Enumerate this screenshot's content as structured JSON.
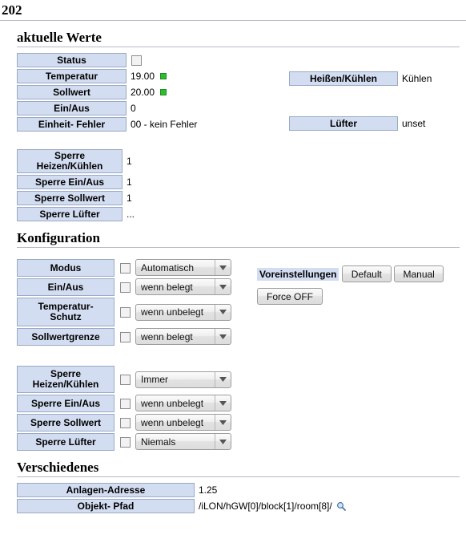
{
  "page": {
    "title": "202"
  },
  "sections": {
    "current_values": {
      "heading": "aktuelle Werte",
      "rows": [
        {
          "label": "Status",
          "value": "",
          "control": "checkbox"
        },
        {
          "label": "Temperatur",
          "value": "19.00",
          "indicator": "green"
        },
        {
          "label": "Sollwert",
          "value": "20.00",
          "indicator": "green"
        },
        {
          "label": "Ein/Aus",
          "value": "0"
        },
        {
          "label": "Einheit- Fehler",
          "value": "00 - kein Fehler"
        }
      ],
      "right_rows": [
        {
          "label": "Heißen/Kühlen",
          "value": "Kühlen"
        },
        {
          "label": "Lüfter",
          "value": "unset"
        }
      ],
      "lock_rows": [
        {
          "label": "Sperre Heizen/Kühlen",
          "value": "1"
        },
        {
          "label": "Sperre Ein/Aus",
          "value": "1"
        },
        {
          "label": "Sperre Sollwert",
          "value": "1"
        },
        {
          "label": "Sperre Lüfter",
          "value": "..."
        }
      ]
    },
    "configuration": {
      "heading": "Konfiguration",
      "group1": [
        {
          "label": "Modus",
          "selected": "Automatisch",
          "checked": false
        },
        {
          "label": "Ein/Aus",
          "selected": "wenn belegt",
          "checked": false
        },
        {
          "label": "Temperatur- Schutz",
          "label_line1": "Temperatur-",
          "label_line2": "Schutz",
          "selected": "wenn unbelegt",
          "checked": false
        },
        {
          "label": "Sollwertgrenze",
          "selected": "wenn belegt",
          "checked": false
        }
      ],
      "group2": [
        {
          "label": "Sperre Heizen/Kühlen",
          "label_line1": "Sperre",
          "label_line2": "Heizen/Kühlen",
          "selected": "Immer",
          "checked": false
        },
        {
          "label": "Sperre Ein/Aus",
          "selected": "wenn unbelegt",
          "checked": false
        },
        {
          "label": "Sperre Sollwert",
          "selected": "wenn unbelegt",
          "checked": false
        },
        {
          "label": "Sperre Lüfter",
          "selected": "Niemals",
          "checked": false
        }
      ],
      "presets": {
        "title": "Voreinstellungen",
        "buttons": [
          "Default",
          "Manual",
          "Force OFF"
        ]
      }
    },
    "misc": {
      "heading": "Verschiedenes",
      "rows": [
        {
          "label": "Anlagen-Adresse",
          "value": "1.25"
        },
        {
          "label": "Objekt- Pfad",
          "value": "/iLON/hGW[0]/block[1]/room[8]/",
          "icon": "magnifier-icon"
        }
      ]
    }
  },
  "colors": {
    "label_bg": "#d3ddf1",
    "label_border": "#9aa9c4",
    "rule": "#b8b8c8",
    "status_green": "#2fbd2f"
  }
}
